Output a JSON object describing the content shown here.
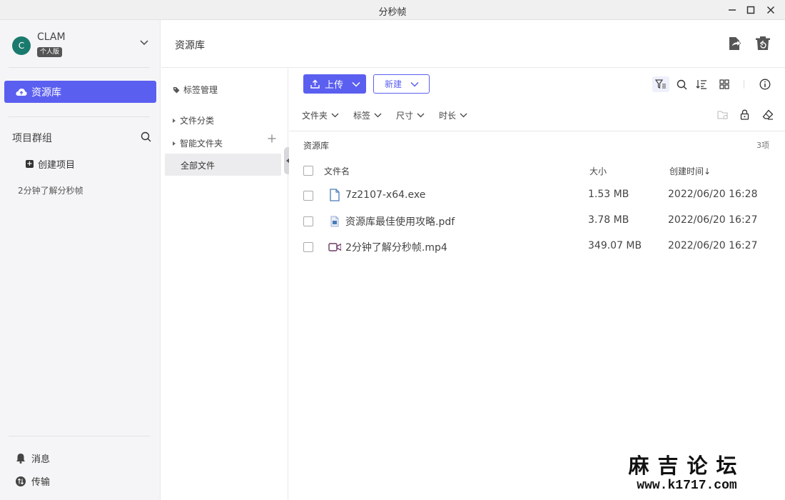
{
  "window": {
    "title": "分秒帧"
  },
  "user": {
    "initial": "C",
    "name": "CLAM",
    "plan_badge": "个人版"
  },
  "sidebar": {
    "library_label": "资源库",
    "projects_header": "项目群组",
    "create_project_label": "创建项目",
    "projects": [
      "2分钟了解分秒帧"
    ],
    "messages_label": "消息",
    "transfer_label": "传输"
  },
  "header": {
    "breadcrumb": "资源库"
  },
  "tree": {
    "tag_manage_label": "标签管理",
    "file_category_label": "文件分类",
    "smart_folder_label": "智能文件夹",
    "all_files_label": "全部文件"
  },
  "toolbar": {
    "upload_label": "上传",
    "new_label": "新建"
  },
  "filters": [
    "文件夹",
    "标签",
    "尺寸",
    "时长"
  ],
  "library": {
    "title": "资源库",
    "count": "3项",
    "columns": {
      "name": "文件名",
      "size": "大小",
      "created": "创建时间↓"
    },
    "files": [
      {
        "name": "7z2107-x64.exe",
        "size": "1.53 MB",
        "created": "2022/06/20 16:28",
        "icon": "file-icon"
      },
      {
        "name": "资源库最佳使用攻略.pdf",
        "size": "3.78 MB",
        "created": "2022/06/20 16:27",
        "icon": "pdf-icon"
      },
      {
        "name": "2分钟了解分秒帧.mp4",
        "size": "349.07 MB",
        "created": "2022/06/20 16:27",
        "icon": "video-icon"
      }
    ]
  },
  "watermark": {
    "line1": "麻吉论坛",
    "line2": "www.k1717.com"
  },
  "colors": {
    "accent": "#5b5ff0",
    "avatar": "#1b7a6e",
    "video_icon": "#6b3b63"
  }
}
